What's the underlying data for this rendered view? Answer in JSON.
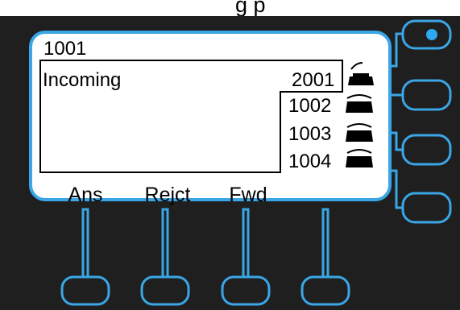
{
  "caption": {
    "text": "g          p"
  },
  "screen": {
    "extension": "1001",
    "status": "Incoming",
    "lines": [
      {
        "number": "2001",
        "icon": "handset-lifted-icon"
      },
      {
        "number": "1002",
        "icon": "phone-icon"
      },
      {
        "number": "1003",
        "icon": "phone-icon"
      },
      {
        "number": "1004",
        "icon": "phone-icon"
      }
    ]
  },
  "softkeys": [
    {
      "label": "Ans"
    },
    {
      "label": "Rejct"
    },
    {
      "label": "Fwd"
    },
    {
      "label": ""
    }
  ],
  "line_buttons": [
    {
      "led": "on"
    },
    {
      "led": "off"
    },
    {
      "led": "off"
    },
    {
      "led": "off"
    }
  ],
  "colors": {
    "bezel": "#1f1f1f",
    "accent": "#3aa6e6",
    "lcd": "#ffffff",
    "led_on": "#2ea8f0"
  }
}
